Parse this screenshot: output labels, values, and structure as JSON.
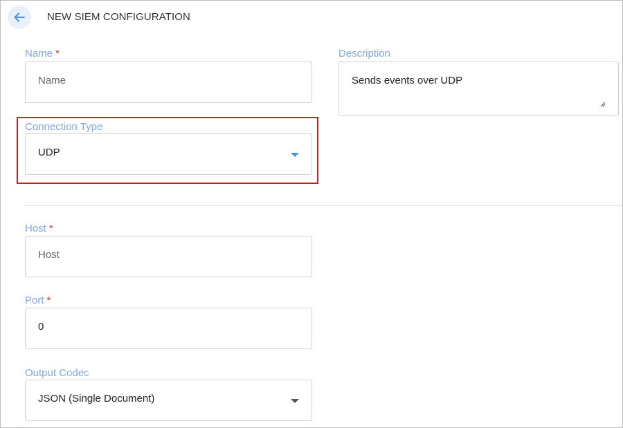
{
  "header": {
    "title": "NEW SIEM CONFIGURATION",
    "back_icon": "arrow-left-icon"
  },
  "form": {
    "name": {
      "label": "Name",
      "required_mark": "*",
      "placeholder": "Name"
    },
    "description": {
      "label": "Description",
      "value": "Sends events over UDP"
    },
    "connection_type": {
      "label": "Connection Type",
      "value": "UDP",
      "icon": "caret-down-icon"
    },
    "host": {
      "label": "Host",
      "required_mark": "*",
      "placeholder": "Host"
    },
    "port": {
      "label": "Port",
      "required_mark": "*",
      "value": "0"
    },
    "output_codec": {
      "label": "Output Codec",
      "value": "JSON (Single Document)",
      "icon": "caret-down-icon"
    }
  },
  "colors": {
    "label": "#7fa8e0",
    "required": "#e53935",
    "highlight": "#e0141e",
    "accent_caret": "#4a8fe8"
  }
}
